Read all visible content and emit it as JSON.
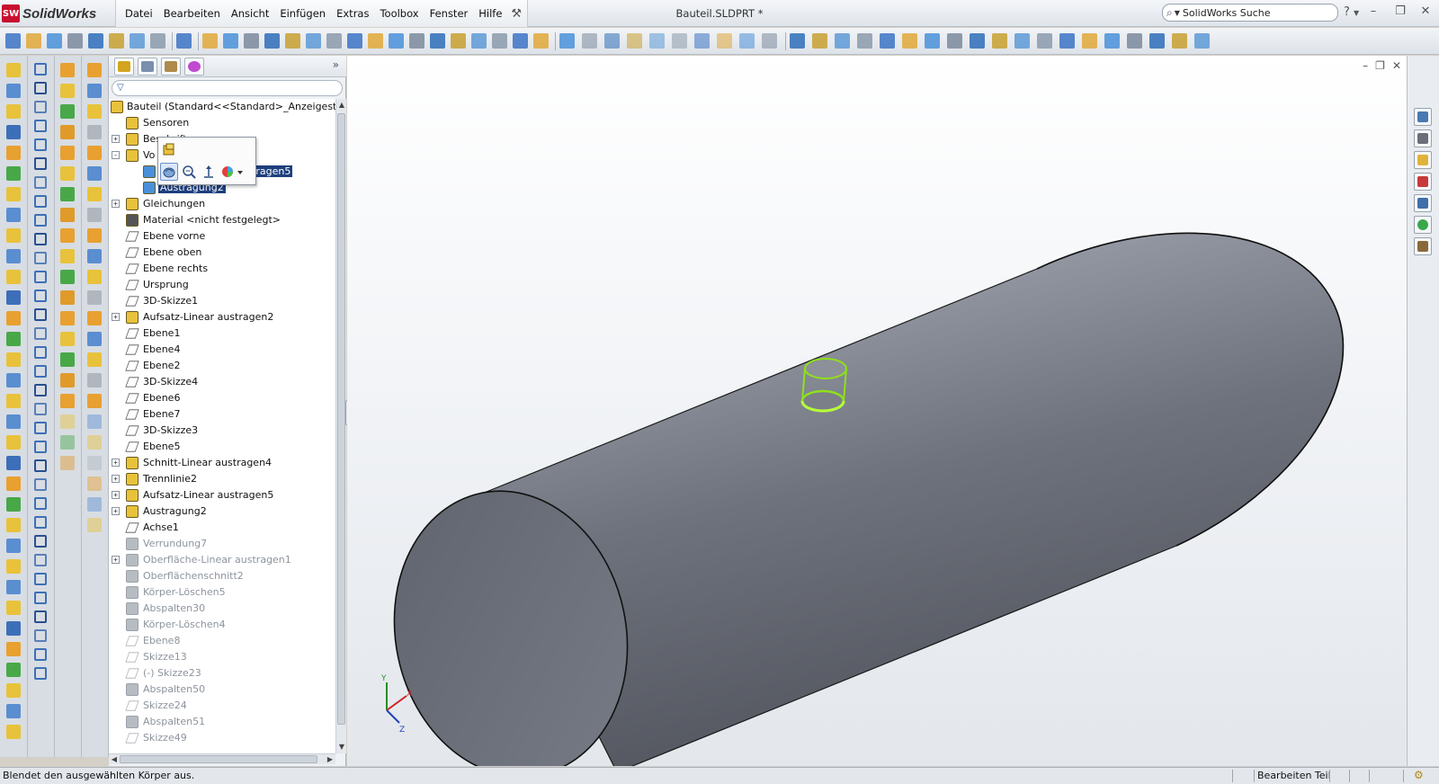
{
  "app": {
    "logo_text": "SolidWorks",
    "document_title": "Bauteil.SLDPRT *"
  },
  "menu": {
    "items": [
      "Datei",
      "Bearbeiten",
      "Ansicht",
      "Einfügen",
      "Extras",
      "Toolbox",
      "Fenster",
      "Hilfe"
    ]
  },
  "search": {
    "placeholder": "SolidWorks Suche"
  },
  "help_glyph": "?",
  "window_controls": {
    "minimize": "–",
    "restore": "❐",
    "close": "✕"
  },
  "viewport_controls": {
    "minimize": "–",
    "restore": "❐",
    "close": "✕"
  },
  "feature_tree": {
    "root_label": "Bauteil  (Standard<<Standard>_Anzeigestatus",
    "items": [
      {
        "label": "Sensoren",
        "icon": "sensor-icon",
        "expand": "",
        "state": "normal"
      },
      {
        "label": "Beschriftungen",
        "icon": "annotation-icon",
        "expand": "+",
        "state": "normal"
      },
      {
        "label": "Vo",
        "icon": "solid-bodies-folder-icon",
        "expand": "-",
        "state": "normal"
      },
      {
        "label": "Aufsatz-Linear austragen5",
        "icon": "body-icon",
        "expand": "",
        "state": "selected",
        "indent": 1
      },
      {
        "label": "Austragung2",
        "icon": "body-icon",
        "expand": "",
        "state": "selected",
        "indent": 1
      },
      {
        "label": "Gleichungen",
        "icon": "equations-icon",
        "expand": "+",
        "state": "normal"
      },
      {
        "label": "Material <nicht festgelegt>",
        "icon": "material-icon",
        "expand": "",
        "state": "normal"
      },
      {
        "label": "Ebene vorne",
        "icon": "plane-icon",
        "expand": "",
        "state": "normal"
      },
      {
        "label": "Ebene oben",
        "icon": "plane-icon",
        "expand": "",
        "state": "normal"
      },
      {
        "label": "Ebene rechts",
        "icon": "plane-icon",
        "expand": "",
        "state": "normal"
      },
      {
        "label": "Ursprung",
        "icon": "origin-icon",
        "expand": "",
        "state": "normal"
      },
      {
        "label": "3D-Skizze1",
        "icon": "sketch3d-icon",
        "expand": "",
        "state": "normal"
      },
      {
        "label": "Aufsatz-Linear austragen2",
        "icon": "extrude-icon",
        "expand": "+",
        "state": "normal"
      },
      {
        "label": "Ebene1",
        "icon": "plane-icon",
        "expand": "",
        "state": "normal"
      },
      {
        "label": "Ebene4",
        "icon": "plane-icon",
        "expand": "",
        "state": "normal"
      },
      {
        "label": "Ebene2",
        "icon": "plane-icon",
        "expand": "",
        "state": "normal"
      },
      {
        "label": "3D-Skizze4",
        "icon": "sketch3d-icon",
        "expand": "",
        "state": "normal"
      },
      {
        "label": "Ebene6",
        "icon": "plane-icon",
        "expand": "",
        "state": "normal"
      },
      {
        "label": "Ebene7",
        "icon": "plane-icon",
        "expand": "",
        "state": "normal"
      },
      {
        "label": "3D-Skizze3",
        "icon": "sketch3d-icon",
        "expand": "",
        "state": "normal"
      },
      {
        "label": "Ebene5",
        "icon": "plane-icon",
        "expand": "",
        "state": "normal"
      },
      {
        "label": "Schnitt-Linear austragen4",
        "icon": "cut-extrude-icon",
        "expand": "+",
        "state": "normal"
      },
      {
        "label": "Trennlinie2",
        "icon": "split-line-icon",
        "expand": "+",
        "state": "normal"
      },
      {
        "label": "Aufsatz-Linear austragen5",
        "icon": "extrude-icon",
        "expand": "+",
        "state": "normal"
      },
      {
        "label": "Austragung2",
        "icon": "sweep-icon",
        "expand": "+",
        "state": "normal"
      },
      {
        "label": "Achse1",
        "icon": "axis-icon",
        "expand": "",
        "state": "normal"
      },
      {
        "label": "Verrundung7",
        "icon": "fillet-icon",
        "expand": "",
        "state": "dim"
      },
      {
        "label": "Oberfläche-Linear austragen1",
        "icon": "surface-extrude-icon",
        "expand": "+",
        "state": "dim"
      },
      {
        "label": "Oberflächenschnitt2",
        "icon": "surface-cut-icon",
        "expand": "",
        "state": "dim"
      },
      {
        "label": "Körper-Löschen5",
        "icon": "delete-body-icon",
        "expand": "",
        "state": "dim"
      },
      {
        "label": "Abspalten30",
        "icon": "split-icon",
        "expand": "",
        "state": "dim"
      },
      {
        "label": "Körper-Löschen4",
        "icon": "delete-body-icon",
        "expand": "",
        "state": "dim"
      },
      {
        "label": "Ebene8",
        "icon": "plane-icon",
        "expand": "",
        "state": "dim"
      },
      {
        "label": "Skizze13",
        "icon": "sketch-icon",
        "expand": "",
        "state": "dim"
      },
      {
        "label": "(-) Skizze23",
        "icon": "sketch-icon",
        "expand": "",
        "state": "dim"
      },
      {
        "label": "Abspalten50",
        "icon": "split-icon",
        "expand": "",
        "state": "dim"
      },
      {
        "label": "Skizze24",
        "icon": "sketch-icon",
        "expand": "",
        "state": "dim"
      },
      {
        "label": "Abspalten51",
        "icon": "split-icon",
        "expand": "",
        "state": "dim"
      },
      {
        "label": "Skizze49",
        "icon": "sketch-icon",
        "expand": "",
        "state": "dim"
      }
    ]
  },
  "context_toolbar": {
    "buttons": [
      "hide-body-icon",
      "zoom-to-selection-icon",
      "normal-to-icon",
      "appearance-icon"
    ]
  },
  "statusbar": {
    "message": "Blendet den ausgewählten Körper aus.",
    "mode": "Bearbeiten Teil"
  },
  "colors": {
    "selection": "#1d3f7d",
    "highlight_green": "#8fe01a",
    "body_gray": "#6d717b",
    "brand_red": "#c8102e"
  }
}
